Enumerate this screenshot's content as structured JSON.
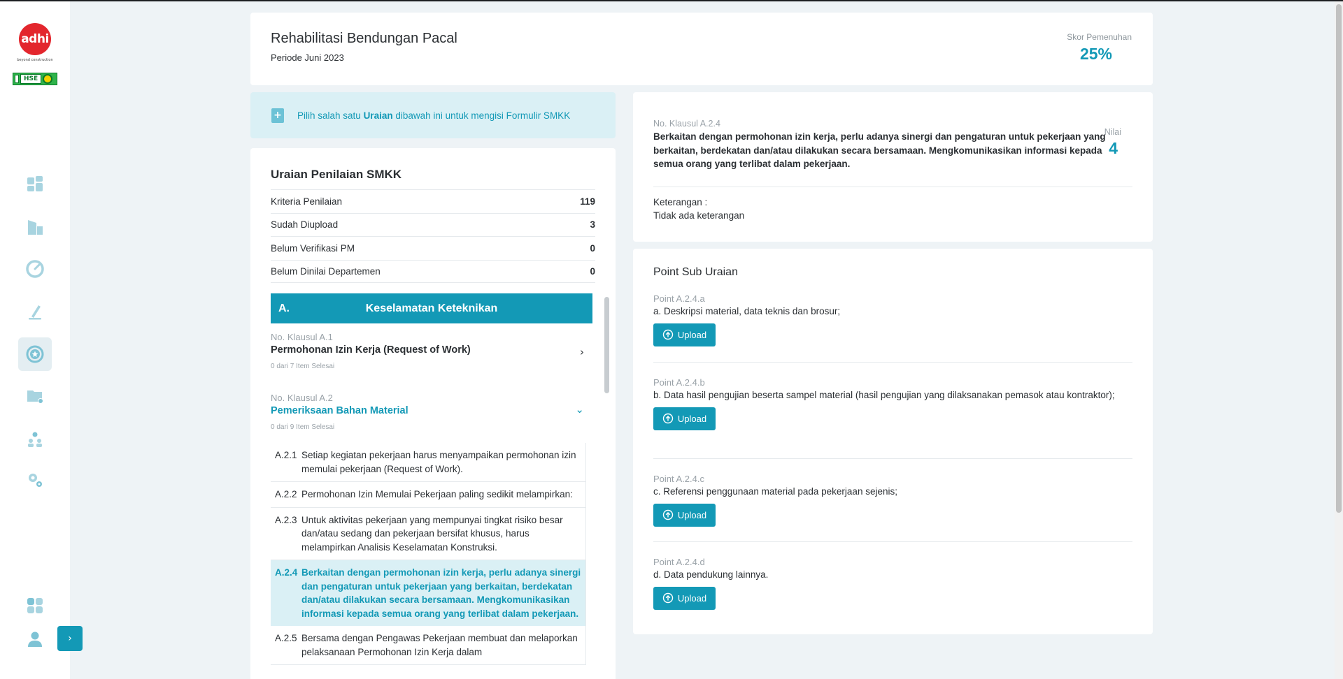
{
  "brand": {
    "logo_text": "adhi",
    "tagline": "beyond construction",
    "badge_text": "HSE",
    "accent": "#1399b6"
  },
  "sidebar": {
    "items": [
      {
        "icon": "dashboard-icon",
        "active": false
      },
      {
        "icon": "building-icon",
        "active": false
      },
      {
        "icon": "gauge-icon",
        "active": false
      },
      {
        "icon": "pen-icon",
        "active": false
      },
      {
        "icon": "star-badge-icon",
        "active": true
      },
      {
        "icon": "folder-settings-icon",
        "active": false
      },
      {
        "icon": "users-settings-icon",
        "active": false
      },
      {
        "icon": "gears-icon",
        "active": false
      }
    ],
    "bottom": [
      {
        "icon": "apps-grid-icon"
      },
      {
        "icon": "user-icon"
      }
    ],
    "collapse_label": "›"
  },
  "header": {
    "title": "Rehabilitasi Bendungan Pacal",
    "period": "Periode Juni 2023",
    "score_label": "Skor Pemenuhan",
    "score_value": "25%"
  },
  "info": {
    "icon_label": "+",
    "text_before": "Pilih salah satu ",
    "text_bold": "Uraian",
    "text_after": " dibawah ini untuk mengisi Formulir SMKK"
  },
  "uraian": {
    "title": "Uraian Penilaian SMKK",
    "stats": [
      {
        "label": "Kriteria Penilaian",
        "value": "119"
      },
      {
        "label": "Sudah Diupload",
        "value": "3"
      },
      {
        "label": "Belum Verifikasi PM",
        "value": "0"
      },
      {
        "label": "Belum Dinilai Departemen",
        "value": "0"
      }
    ],
    "section": {
      "code": "A.",
      "name": "Keselamatan Keteknikan"
    },
    "klausul": [
      {
        "num": "No. Klausul A.1",
        "title": "Permohonan Izin Kerja (Request of Work)",
        "progress": "0 dari 7 Item Selesai",
        "chevron": "›"
      },
      {
        "num": "No. Klausul A.2",
        "title": "Pemeriksaan Bahan Material",
        "progress": "0 dari 9 Item Selesai",
        "chevron": "⌄"
      }
    ],
    "sub_items": [
      {
        "code": "A.2.1",
        "text": "Setiap kegiatan pekerjaan harus menyampaikan permohonan izin memulai pekerjaan (Request of Work)."
      },
      {
        "code": "A.2.2",
        "text": "Permohonan Izin Memulai Pekerjaan paling sedikit melampirkan:"
      },
      {
        "code": "A.2.3",
        "text": "Untuk aktivitas pekerjaan yang mempunyai tingkat risiko besar dan/atau sedang dan pekerjaan bersifat khusus, harus melampirkan Analisis Keselamatan Konstruksi."
      },
      {
        "code": "A.2.4",
        "text": "Berkaitan dengan permohonan izin kerja, perlu adanya sinergi dan pengaturan untuk pekerjaan yang berkaitan, berdekatan dan/atau dilakukan secara bersamaan. Mengkomunikasikan informasi kepada semua orang yang terlibat dalam pekerjaan."
      },
      {
        "code": "A.2.5",
        "text": "Bersama dengan Pengawas Pekerjaan membuat dan melaporkan pelaksanaan Permohonan Izin Kerja dalam"
      }
    ]
  },
  "detail": {
    "num": "No. Klausul A.2.4",
    "text": "Berkaitan dengan permohonan izin kerja, perlu adanya sinergi dan pengaturan untuk pekerjaan yang berkaitan, berdekatan dan/atau dilakukan secara bersamaan. Mengkomunikasikan informasi kepada semua orang yang terlibat dalam pekerjaan.",
    "nilai_label": "Nilai",
    "nilai_value": "4",
    "keterangan_label": "Keterangan :",
    "keterangan_value": "Tidak ada keterangan"
  },
  "points": {
    "title": "Point Sub Uraian",
    "upload_label": "Upload",
    "items": [
      {
        "num": "Point A.2.4.a",
        "text": "a. Deskripsi material, data teknis dan brosur;"
      },
      {
        "num": "Point A.2.4.b",
        "text": "b. Data hasil pengujian beserta sampel material (hasil pengujian yang dilaksanakan pemasok atau kontraktor);"
      },
      {
        "num": "Point A.2.4.c",
        "text": "c. Referensi penggunaan material pada pekerjaan sejenis;"
      },
      {
        "num": "Point A.2.4.d",
        "text": "d. Data pendukung lainnya."
      }
    ]
  }
}
